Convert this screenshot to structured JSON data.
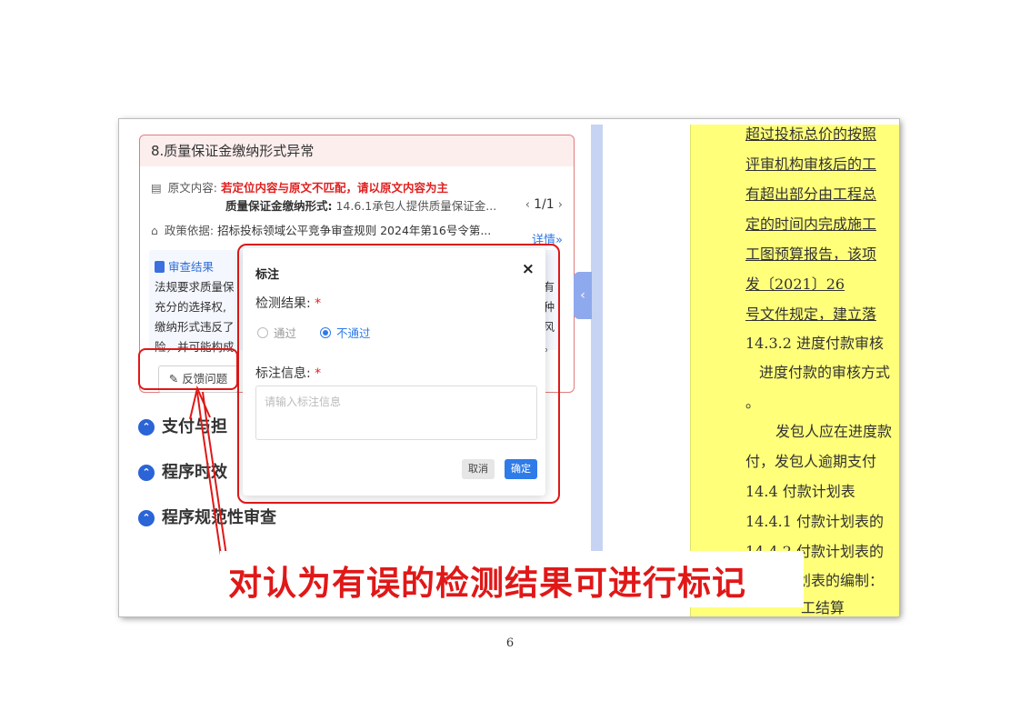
{
  "card": {
    "title": "8.质量保证金缴纳形式异常",
    "original_label": "原文内容:",
    "original_warning": "若定位内容与原文不匹配，请以原文内容为主",
    "original_key": "质量保证金缴纳形式:",
    "original_value": "14.6.1承包人提供质量保证金...",
    "pager": "1/1",
    "policy_label": "政策依据:",
    "policy_value": "招标投标领域公平竞争审查规则 2024年第16号令第...",
    "detail_link": "详情»",
    "result_title": "审查结果",
    "result_lines_left": [
      "法规要求质量保",
      "充分的选择权,",
      "缴纳形式违反了",
      "险，并可能构成"
    ],
    "result_lines_right": [
      "有",
      "种",
      "风",
      "。"
    ],
    "feedback_button": "反馈问题"
  },
  "sections": [
    "支付与担",
    "程序时效",
    "程序规范性审查"
  ],
  "dialog": {
    "title": "标注",
    "close": "×",
    "result_label": "检测结果:",
    "required_mark": "*",
    "option_pass": "通过",
    "option_fail": "不通过",
    "selected": "不通过",
    "info_label": "标注信息:",
    "info_placeholder": "请输入标注信息",
    "cancel": "取消",
    "confirm": "确定"
  },
  "document_lines": [
    "超过投标总价的按照",
    "评审机构审核后的工",
    "有超出部分由工程总",
    "定的时间内完成施工",
    "工图预算报告，该项",
    "发〔2021〕26",
    "号文件规定，建立落",
    "14.3.2 进度付款审核",
    "进度付款的审核方式",
    "。",
    "发包人应在进度款",
    "付，发包人逾期支付",
    "14.4  付款计划表",
    "14.4.1 付款计划表的",
    "14.4.2 付款计划表的",
    "划表的编制：",
    "工结算"
  ],
  "caption": "对认为有误的检测结果可进行标记",
  "page_number": "6",
  "colors": {
    "accent": "#2f7be8",
    "highlight": "#e01818",
    "doc_highlight": "#ffff7a"
  }
}
